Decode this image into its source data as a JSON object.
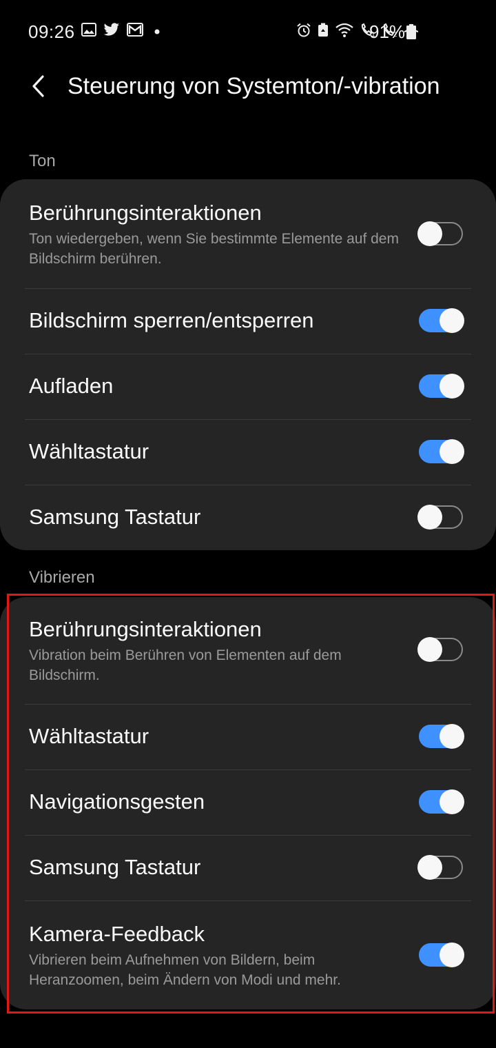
{
  "status_bar": {
    "time": "09:26",
    "battery_pct": "91%",
    "icons_left": [
      "gallery-icon",
      "twitter-icon",
      "gmail-icon",
      "dot-icon"
    ],
    "icons_right": [
      "alarm-icon",
      "android-icon",
      "wifi-call-icon",
      "volte1-icon",
      "volte2-icon",
      "airplane-icon",
      "battery-icon"
    ]
  },
  "header": {
    "back_icon": "back-chevron-icon",
    "title": "Steuerung von Systemton/-vibration"
  },
  "sections": {
    "ton": {
      "label": "Ton",
      "rows": [
        {
          "title": "Berührungsinteraktionen",
          "subtitle": "Ton wiedergeben, wenn Sie bestimmte Elemente auf dem Bildschirm berühren.",
          "on": false
        },
        {
          "title": "Bildschirm sperren/entsperren",
          "on": true
        },
        {
          "title": "Aufladen",
          "on": true
        },
        {
          "title": "Wähltastatur",
          "on": true
        },
        {
          "title": "Samsung Tastatur",
          "on": false
        }
      ]
    },
    "vibrieren": {
      "label": "Vibrieren",
      "rows": [
        {
          "title": "Berührungsinteraktionen",
          "subtitle": "Vibration beim Berühren von Elementen auf dem Bildschirm.",
          "on": false
        },
        {
          "title": "Wähltastatur",
          "on": true
        },
        {
          "title": "Navigationsgesten",
          "on": true
        },
        {
          "title": "Samsung Tastatur",
          "on": false
        },
        {
          "title": "Kamera-Feedback",
          "subtitle": "Vibrieren beim Aufnehmen von Bildern, beim Heranzoomen, beim Ändern von Modi und mehr.",
          "on": true
        }
      ]
    }
  },
  "colors": {
    "background": "#000000",
    "card": "#252525",
    "accent": "#3e91ff",
    "highlight": "#e01818"
  }
}
